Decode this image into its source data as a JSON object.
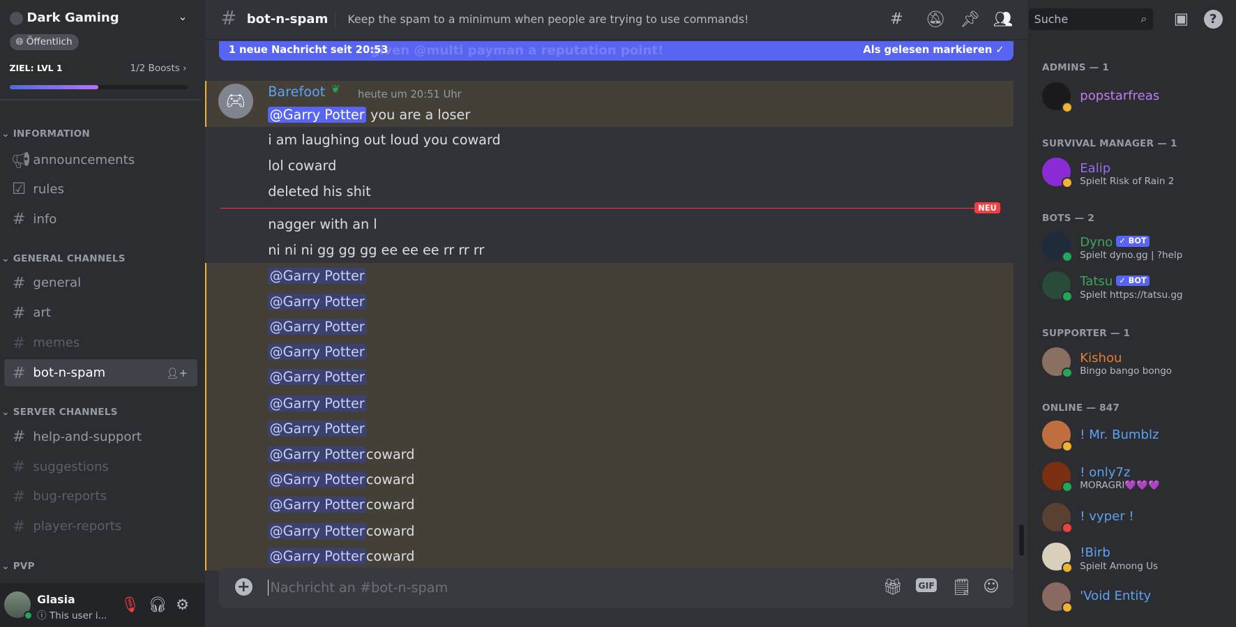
{
  "server": {
    "name": "Dark Gaming",
    "visibility": "Öffentlich",
    "goal": "ZIEL: LVL 1",
    "boosts": "1/2 Boosts",
    "boost_progress": 0.5
  },
  "categories": [
    {
      "name": "INFORMATION",
      "channels": [
        {
          "name": "announcements",
          "icon": "megaphone-icon"
        },
        {
          "name": "rules",
          "icon": "checkbox-icon"
        },
        {
          "name": "info",
          "icon": "hash-icon"
        }
      ]
    },
    {
      "name": "GENERAL CHANNELS",
      "channels": [
        {
          "name": "general",
          "icon": "hash-icon"
        },
        {
          "name": "art",
          "icon": "hash-icon"
        },
        {
          "name": "memes",
          "icon": "hash-icon",
          "muted": true
        },
        {
          "name": "bot-n-spam",
          "icon": "hash-icon",
          "selected": true
        }
      ]
    },
    {
      "name": "SERVER CHANNELS",
      "channels": [
        {
          "name": "help-and-support",
          "icon": "hash-icon"
        },
        {
          "name": "suggestions",
          "icon": "hash-icon",
          "muted": true
        },
        {
          "name": "bug-reports",
          "icon": "hash-icon",
          "muted": true
        },
        {
          "name": "player-reports",
          "icon": "hash-icon",
          "muted": true
        }
      ]
    },
    {
      "name": "PVP",
      "channels": []
    }
  ],
  "user": {
    "name": "Glasia",
    "status": "This user i..."
  },
  "channel": {
    "name": "bot-n-spam",
    "topic": "Keep the spam to a minimum when people are trying to use commands!"
  },
  "new_bar": {
    "text": "1 neue Nachricht seit 20:53",
    "ghost": "given @multi payman a reputation point!",
    "action": "Als gelesen markieren"
  },
  "message": {
    "author": "Barefoot",
    "timestamp": "heute um 20:51 Uhr",
    "author_color": "#5ea1f2",
    "lines": [
      {
        "mention": "@Garry Potter",
        "text": " you are a loser",
        "hl": true
      },
      {
        "text": "i am laughing out loud you coward"
      },
      {
        "text": "lol coward"
      },
      {
        "text": "deleted his shit"
      },
      {
        "text": "nagger with an l"
      },
      {
        "text": "ni ni ni gg gg gg ee ee ee rr rr rr"
      },
      {
        "mention": "@Garry Potter",
        "text": "",
        "hl": true
      },
      {
        "mention": "@Garry Potter",
        "text": "",
        "hl": true
      },
      {
        "mention": "@Garry Potter",
        "text": "",
        "hl": true
      },
      {
        "mention": "@Garry Potter",
        "text": "",
        "hl": true
      },
      {
        "mention": "@Garry Potter",
        "text": "",
        "hl": true
      },
      {
        "mention": "@Garry Potter",
        "text": "",
        "hl": true
      },
      {
        "mention": "@Garry Potter",
        "text": "",
        "hl": true
      },
      {
        "mention": "@Garry Potter",
        "text": "coward",
        "hl": true
      },
      {
        "mention": "@Garry Potter",
        "text": "coward",
        "hl": true
      },
      {
        "mention": "@Garry Potter",
        "text": "coward",
        "hl": true
      },
      {
        "mention": "@Garry Potter",
        "text": "coward",
        "hl": true
      },
      {
        "mention": "@Garry Potter",
        "text": "coward",
        "hl": true
      }
    ]
  },
  "divider": "NEU",
  "composer": {
    "placeholder": "Nachricht an #bot-n-spam",
    "gif": "GIF"
  },
  "search": {
    "placeholder": "Suche"
  },
  "members": [
    {
      "group": "ADMINS — 1",
      "items": [
        {
          "name": "popstarfreas",
          "color": "#c27cf2",
          "status": "idle",
          "avatar": "#1a1a1a"
        }
      ]
    },
    {
      "group": "SURVIVAL MANAGER — 1",
      "items": [
        {
          "name": "Ealip",
          "color": "#9b6cf2",
          "sub": "Spielt Risk of Rain 2",
          "status": "idle",
          "avatar": "#8b2bd6"
        }
      ]
    },
    {
      "group": "BOTS — 2",
      "items": [
        {
          "name": "Dyno",
          "color": "#3ba55d",
          "bot": "✓ BOT",
          "sub": "Spielt dyno.gg | ?help",
          "status": "online",
          "avatar": "#1f2a3a"
        },
        {
          "name": "Tatsu",
          "color": "#3ba55d",
          "bot": "✓ BOT",
          "sub": "Spielt https://tatsu.gg",
          "status": "online",
          "avatar": "#2a4a3a"
        }
      ]
    },
    {
      "group": "SUPPORTER — 1",
      "items": [
        {
          "name": "Kishou",
          "color": "#e67e38",
          "sub": "Bingo bango bongo",
          "status": "online",
          "avatar": "#8a7060"
        }
      ]
    },
    {
      "group": "ONLINE — 847",
      "items": [
        {
          "name": "! Mr. Bumblz",
          "color": "#5ea1f2",
          "status": "idle",
          "avatar": "#c07040"
        },
        {
          "name": "! only7z",
          "color": "#5ea1f2",
          "sub": "MORAGRI💜💜💜",
          "status": "online",
          "avatar": "#7a3010"
        },
        {
          "name": "! vyper !",
          "color": "#5ea1f2",
          "status": "dnd",
          "avatar": "#5a4030"
        },
        {
          "name": "!Birb",
          "color": "#5ea1f2",
          "sub": "Spielt Among Us",
          "status": "idle",
          "avatar": "#d8d0b8"
        },
        {
          "name": "'Void Entity",
          "color": "#5ea1f2",
          "status": "idle",
          "avatar": "#8a6a60"
        }
      ]
    }
  ],
  "status_colors": {
    "online": "#23a55a",
    "idle": "#f0b232",
    "dnd": "#f23f43"
  }
}
